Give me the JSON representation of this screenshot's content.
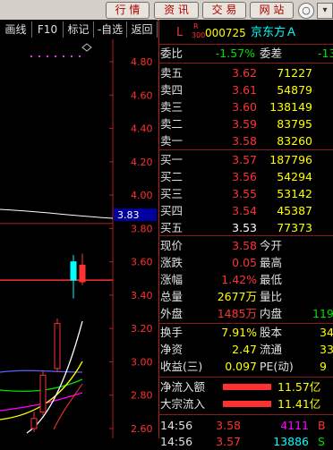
{
  "toolbar": {
    "buttons": [
      "行 情",
      "资 讯",
      "交 易",
      "网 站"
    ],
    "round_button": "○"
  },
  "chart_toolbar": {
    "items": [
      "画线",
      "F10",
      "标记",
      "-自选",
      "返回"
    ]
  },
  "chart": {
    "y_ticks": [
      "4.80",
      "4.60",
      "4.40",
      "4.20",
      "4.00",
      "3.80",
      "3.60",
      "3.40",
      "3.20",
      "3.00",
      "2.80",
      "2.60"
    ],
    "current_price_tag": "3.83"
  },
  "chart_data": {
    "type": "candlestick",
    "ylim": [
      2.6,
      4.8
    ],
    "candles": [
      {
        "open": 2.6,
        "close": 2.66,
        "high": 2.7,
        "low": 2.58
      },
      {
        "open": 2.7,
        "close": 2.92,
        "high": 2.95,
        "low": 2.68
      },
      {
        "open": 2.96,
        "close": 3.23,
        "high": 3.26,
        "low": 2.94
      },
      {
        "open": 3.49,
        "close": 3.6,
        "high": 3.64,
        "low": 3.38
      },
      {
        "open": 3.58,
        "close": 3.48,
        "high": 3.65,
        "low": 3.46
      }
    ],
    "levels": [
      3.83,
      3.49
    ]
  },
  "header": {
    "flag": "L",
    "tag_top": "R",
    "tag_bottom": "300",
    "code": "000725",
    "name": "京东方Ａ"
  },
  "commission": {
    "ratio_label": "委比",
    "ratio_value": "-1.57%",
    "diff_label": "委差",
    "diff_value": "-13"
  },
  "asks": [
    {
      "label": "卖五",
      "price": "3.62",
      "vol": "71227"
    },
    {
      "label": "卖四",
      "price": "3.61",
      "vol": "54879"
    },
    {
      "label": "卖三",
      "price": "3.60",
      "vol": "138149"
    },
    {
      "label": "卖二",
      "price": "3.59",
      "vol": "83795"
    },
    {
      "label": "卖一",
      "price": "3.58",
      "vol": "83260"
    }
  ],
  "bids": [
    {
      "label": "买一",
      "price": "3.57",
      "vol": "187796"
    },
    {
      "label": "买二",
      "price": "3.56",
      "vol": "54294"
    },
    {
      "label": "买三",
      "price": "3.55",
      "vol": "53142"
    },
    {
      "label": "买四",
      "price": "3.54",
      "vol": "45387"
    },
    {
      "label": "买五",
      "price": "3.53",
      "vol": "77373"
    }
  ],
  "stats": {
    "price_label": "现价",
    "price": "3.58",
    "open_label": "今开",
    "open": "",
    "change_label": "涨跌",
    "change": "0.05",
    "high_label": "最高",
    "high": "",
    "pct_label": "涨幅",
    "pct": "1.42%",
    "low_label": "最低",
    "low": "",
    "vol_label": "总量",
    "vol": "2677万",
    "ratio_label": "量比",
    "ratio": "",
    "outer_label": "外盘",
    "outer": "1485万",
    "inner_label": "内盘",
    "inner": "119"
  },
  "stats2": {
    "turnover_label": "换手",
    "turnover": "7.91%",
    "equity_label": "股本",
    "equity": "34",
    "net_label": "净资",
    "net": "2.47",
    "float_label": "流通",
    "float": "33",
    "eps_label": "收益(三)",
    "eps": "0.097",
    "pe_label": "PE(动)",
    "pe": "9"
  },
  "flows": [
    {
      "label": "净流入额",
      "value": "11.57亿"
    },
    {
      "label": "大宗流入",
      "value": "11.41亿"
    }
  ],
  "ticks": [
    {
      "time": "14:56",
      "price": "3.58",
      "vol": "4111",
      "side": "B"
    },
    {
      "time": "14:56",
      "price": "3.57",
      "vol": "13886",
      "side": "S"
    }
  ]
}
